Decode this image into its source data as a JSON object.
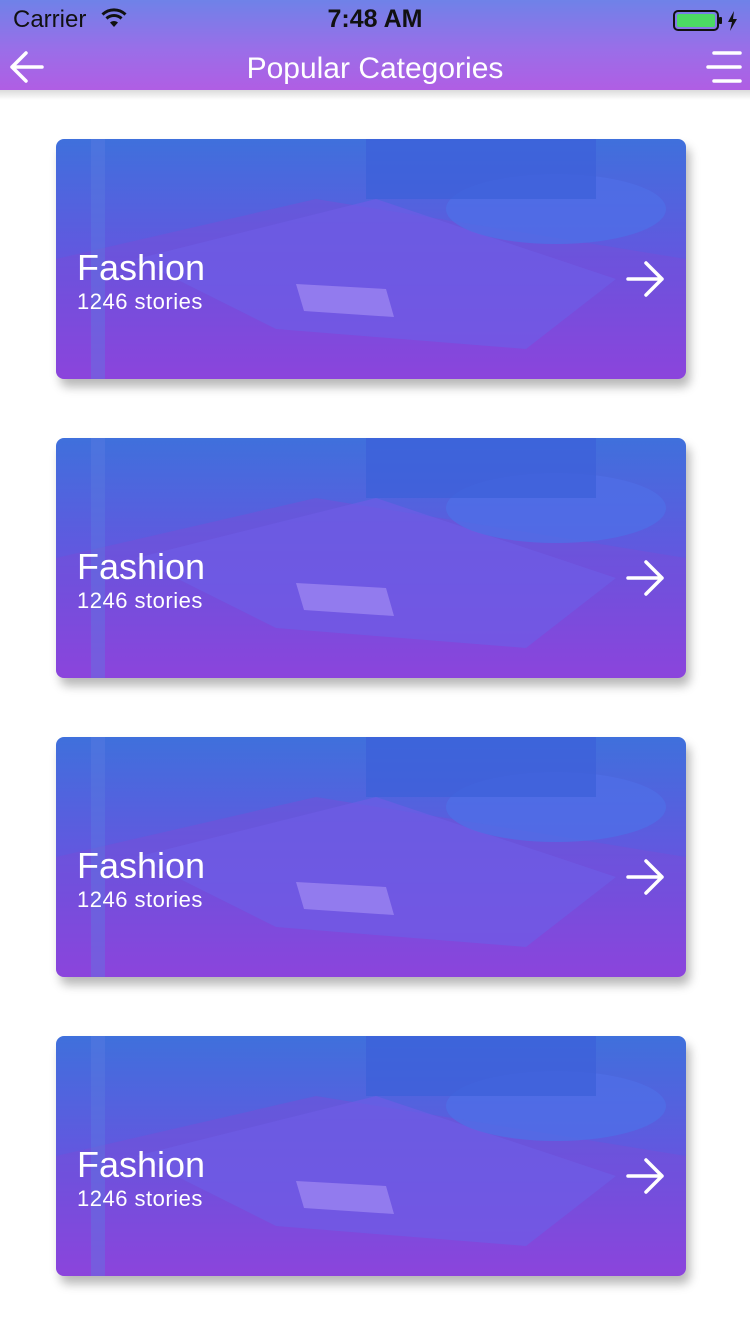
{
  "status_bar": {
    "carrier": "Carrier",
    "time": "7:48 AM",
    "wifi_icon": "wifi-icon",
    "battery_icon": "battery-charging-icon"
  },
  "header": {
    "title": "Popular Categories",
    "back_icon": "arrow-left-icon",
    "menu_icon": "menu-icon"
  },
  "colors": {
    "header_top": "#6f82e8",
    "header_bottom": "#b05ee4",
    "card_overlay_top": "#3f6ee0",
    "card_overlay_bottom": "#9a3fe0"
  },
  "categories": [
    {
      "name": "Fashion",
      "count": "1246 stories"
    },
    {
      "name": "Fashion",
      "count": "1246 stories"
    },
    {
      "name": "Fashion",
      "count": "1246 stories"
    },
    {
      "name": "Fashion",
      "count": "1246 stories"
    }
  ]
}
